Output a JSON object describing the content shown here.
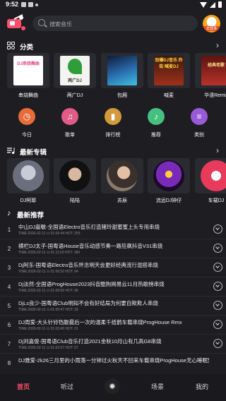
{
  "status": {
    "time": "9:52"
  },
  "search": {
    "placeholder": "搜索音乐"
  },
  "avatar": {
    "badge": "去登录"
  },
  "sections": {
    "category": "分类",
    "albums": "最新专辑",
    "recommend": "最新推荐"
  },
  "categories": [
    {
      "label": "串烧舞曲",
      "art_text": "DJ串烧舞曲",
      "color": "#e04a8a"
    },
    {
      "label": "两广DJ",
      "art_text": "两广DJ",
      "color": "#2f9e3a"
    },
    {
      "label": "包厢",
      "art_text": "",
      "color": "#2a6fb0"
    },
    {
      "label": "喊麦",
      "art_text": "劲爆DJ音乐 炸街 喊麦DJ",
      "color": "#d84a1a"
    },
    {
      "label": "华语Remix",
      "art_text": "经典老歌",
      "color": "#b8322a"
    }
  ],
  "quick": [
    {
      "label": "今日",
      "icon": "clock-icon",
      "glyph": "◷",
      "color": "#e86b3a"
    },
    {
      "label": "歌单",
      "icon": "playlist-icon",
      "glyph": "♫",
      "color": "#e25a86"
    },
    {
      "label": "排行榜",
      "icon": "chart-icon",
      "glyph": "▮",
      "color": "#d19a3a"
    },
    {
      "label": "推荐",
      "icon": "music-note-icon",
      "glyph": "♪",
      "color": "#46c07e"
    },
    {
      "label": "类别",
      "icon": "category-icon",
      "glyph": "≡",
      "color": "#9a5ad8"
    }
  ],
  "albums": [
    {
      "label": "DJ阿耶",
      "color": "#8d8fa0"
    },
    {
      "label": "陆陆",
      "color": "#3b3b44"
    },
    {
      "label": "苏辰",
      "color": "#6a5a52"
    },
    {
      "label": "流远DJ钟仔",
      "color": "#c45bd8"
    },
    {
      "label": "车载DJ",
      "color": "#e83a5a"
    }
  ],
  "songs": [
    {
      "num": "1",
      "title": "中山DJ嘉敏-全国语Electro音乐打造猪玲甜蜜蜜上头专用串烧",
      "meta": "TIME:2026-02-11  ⊙ 01:06:44  HOT: 255"
    },
    {
      "num": "2",
      "title": "横栏DJ太子-国粤语House音乐动感节奏一路狂飙抖音V31串烧",
      "meta": "TIME:2026-02-11  ⊙ 01:11:03  HOT: 180"
    },
    {
      "num": "3",
      "title": "Dj阿东-国粤语Electro音乐怀念明天会更好经典流行混搭串烧",
      "meta": "TIME:2026-02-11  ⊙ 01:06:50  HOT: 64"
    },
    {
      "num": "4",
      "title": "Dj淡然-全国语ProgHouse2023抖音酷狗网易云11月热歌榜串烧",
      "meta": "TIME:2026-02-11  ⊙ 01:09:56  HOT: 96"
    },
    {
      "num": "5",
      "title": "DjLs良少-国粤语Club明知不会有好结局为何要自欺欺人串烧",
      "meta": "TIME:2026-02-11  ⊙ 01:00:47  HOT: 33"
    },
    {
      "num": "6",
      "title": "DJ周爱-大头针铃铛躯最后一次的温柔千纸鹤车载串烧ProgHouse Rmx",
      "meta": "TIME:2026-02-11  ⊙ 01:03:45  HOT: 21"
    },
    {
      "num": "7",
      "title": "Dj刘嘉俊-国粤语Club音乐打造2021金秋10月山有几高G8串烧",
      "meta": "TIME:2026-02-11  ⊙ 01:02:07  HOT: 57"
    },
    {
      "num": "8",
      "title": "DJ雅爱-2k26三月里的小雨落一分钟过火秋天不回来车载串烧ProgHouse无心睡眠野R",
      "meta": ""
    }
  ],
  "tabs": {
    "home": "首页",
    "listen": "听过",
    "scene": "场景",
    "mine": "我的"
  }
}
